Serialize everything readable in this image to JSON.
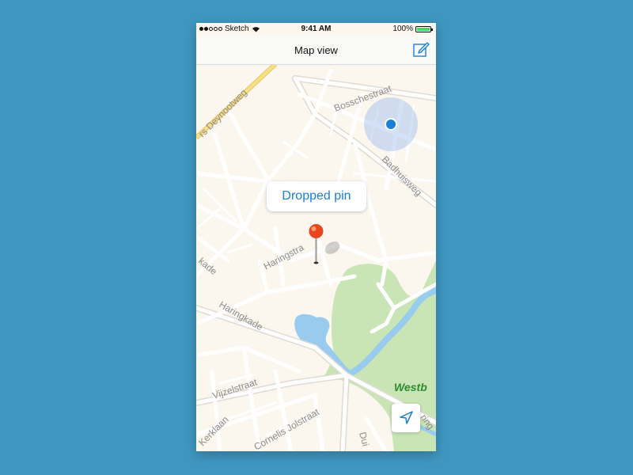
{
  "status_bar": {
    "carrier": "Sketch",
    "time": "9:41 AM",
    "battery": "100%",
    "signal_icon": "signal-dots-icon",
    "wifi_icon": "wifi-icon",
    "battery_icon": "battery-icon"
  },
  "nav": {
    "title": "Map view",
    "right_icon": "compose-icon"
  },
  "map": {
    "callout_label": "Dropped pin",
    "streets": {
      "bosschestraat": "Bosschestraat",
      "badhuisweg": "Badhuisweg",
      "deynootweg": "rs Deynootweg",
      "haringstraat": "Haringstra",
      "kade": "kade",
      "haringkade": "Haringkade",
      "vijzelstraat": "Vijzelstraat",
      "kerklaan": "Kerklaan",
      "cornelis": "Cornelis Jolstraat",
      "park": "Westb",
      "duin": "Dui",
      "ring": "ring"
    },
    "user_location_icon": "user-location-icon",
    "pin_icon": "map-pin-icon",
    "locate_icon": "location-arrow-icon"
  },
  "colors": {
    "background": "#3f97c0",
    "land": "#fbf7ef",
    "road": "#ffffff",
    "road_casing": "#e0dbd1",
    "major_road": "#f2d779",
    "park": "#c9e4b5",
    "water": "#99cbee",
    "accent": "#1a7fd8",
    "pin": "#e8461c",
    "park_label": "#2e8b2e"
  }
}
